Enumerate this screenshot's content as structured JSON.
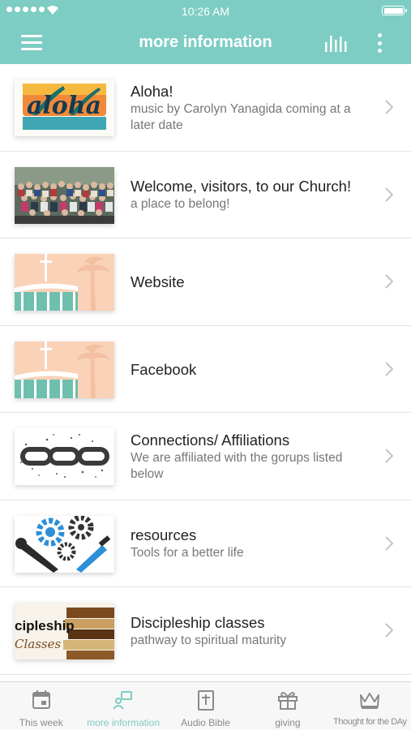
{
  "status_bar": {
    "time": "10:26 AM"
  },
  "header": {
    "title": "more information"
  },
  "list": {
    "items": [
      {
        "title": "Aloha!",
        "subtitle": "music by Carolyn Yanagida  coming at a later date",
        "thumb": "aloha",
        "thumb_text": "aloha"
      },
      {
        "title": "Welcome, visitors, to our  Church!",
        "subtitle": "a place to belong!",
        "thumb": "group-photo"
      },
      {
        "title": "Website",
        "subtitle": "",
        "thumb": "church-beach"
      },
      {
        "title": "Facebook",
        "subtitle": "",
        "thumb": "church-beach"
      },
      {
        "title": "Connections/ Affiliations",
        "subtitle": "We are affiliated with the gorups listed below",
        "thumb": "chain"
      },
      {
        "title": "resources",
        "subtitle": "Tools for a better life",
        "thumb": "gears-tools"
      },
      {
        "title": "Discipleship classes",
        "subtitle": "pathway to spiritual maturity",
        "thumb": "books",
        "thumb_text": "cipleship",
        "thumb_text2": "Classes"
      }
    ]
  },
  "tabs": [
    {
      "label": "This week",
      "icon": "calendar-icon",
      "active": false
    },
    {
      "label": "more information",
      "icon": "people-icon",
      "active": true
    },
    {
      "label": "Audio Bible",
      "icon": "bible-icon",
      "active": false
    },
    {
      "label": "giving",
      "icon": "gift-icon",
      "active": false
    },
    {
      "label": "Thought for the DAy",
      "icon": "crown-icon",
      "active": false
    }
  ],
  "colors": {
    "accent": "#7ecdc4",
    "tab_inactive": "#8a8a8a"
  }
}
